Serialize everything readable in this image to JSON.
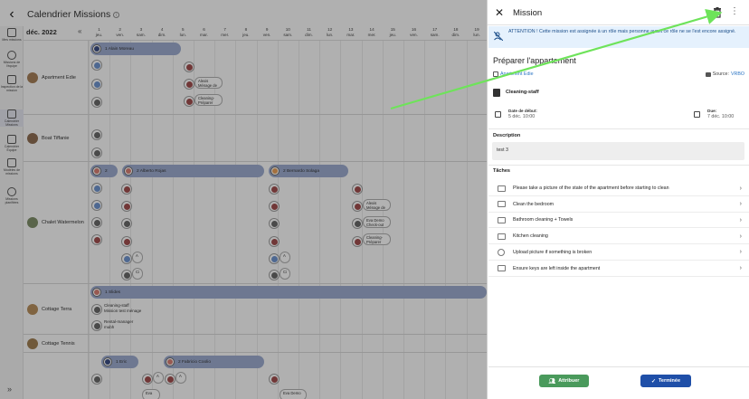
{
  "calendar": {
    "title": "Calendrier Missions",
    "info_icon": "info-icon",
    "month": "déc. 2022",
    "nav_prev": "«",
    "days": [
      {
        "num": "1",
        "dow": "jeu."
      },
      {
        "num": "2",
        "dow": "ven."
      },
      {
        "num": "3",
        "dow": "sam."
      },
      {
        "num": "4",
        "dow": "dim."
      },
      {
        "num": "5",
        "dow": "lun."
      },
      {
        "num": "6",
        "dow": "mar."
      },
      {
        "num": "7",
        "dow": "mer."
      },
      {
        "num": "8",
        "dow": "jeu."
      },
      {
        "num": "9",
        "dow": "ven."
      },
      {
        "num": "10",
        "dow": "sam."
      },
      {
        "num": "11",
        "dow": "dim."
      },
      {
        "num": "12",
        "dow": "lun."
      },
      {
        "num": "13",
        "dow": "mar."
      },
      {
        "num": "14",
        "dow": "mer."
      },
      {
        "num": "15",
        "dow": "jeu."
      },
      {
        "num": "16",
        "dow": "ven."
      },
      {
        "num": "17",
        "dow": "sam."
      },
      {
        "num": "18",
        "dow": "dim."
      },
      {
        "num": "19",
        "dow": "lun."
      }
    ],
    "sidebar": [
      {
        "label": "Mes missions",
        "icon": "calendar-icon"
      },
      {
        "label": "Missions de l'équipe",
        "icon": "team-icon"
      },
      {
        "label": "Inspection de la mission",
        "icon": "inspection-icon"
      },
      {
        "label": "Calendrier Missions",
        "icon": "calendar-icon",
        "active": true
      },
      {
        "label": "Calendrier Équipe",
        "icon": "calendar-team-icon"
      },
      {
        "label": "Modèles de missions",
        "icon": "template-icon"
      },
      {
        "label": "Missions planifiées",
        "icon": "clock-icon"
      }
    ],
    "expand_label": "»",
    "properties": [
      {
        "name": "Apartment Edie"
      },
      {
        "name": "Boat Tiffanie"
      },
      {
        "name": "Chalet Watermelon"
      },
      {
        "name": "Cottage Terra"
      },
      {
        "name": "Cottage Tennis"
      }
    ],
    "bands": {
      "alain": "1  Alain Moreau",
      "alberto": "2  Alberto Rojas",
      "bernardo": "2  Bernardo Solaga",
      "slides": "1  Slides",
      "eric": "1  Eric",
      "fabricio": "2  Fabricio Coolio",
      "two": "2"
    },
    "chips": {
      "alexis_menage": "Alexis\nMénage de",
      "cleaning_preparer": "Cleaning-\nPréparer",
      "alexis_menage2": "Alexis\nMénage de",
      "eva_check": "Eva Demo\nCheck-out",
      "cleaning_preparer2": "Cleaning-\nPréparer",
      "a1": "A",
      "a2": "A",
      "a3": "A",
      "a4": "A",
      "ci": "Ci",
      "ci2": "Ci",
      "eva": "Eva",
      "eva_demo": "Eva Demo"
    },
    "texts": {
      "cleaning_staff_line1": "Cleaning-staff",
      "cleaning_staff_line2": "Mission test ménage",
      "rental_manager_line1": "Rental-manager",
      "rental_manager_line2": "mubh"
    }
  },
  "panel": {
    "title": "Mission",
    "close_icon": "close-icon",
    "delete_icon": "trash-icon",
    "more_icon": "more-vertical-icon",
    "alert": "ATTENTION ! Cette mission est assignée à un rôle mais personne ayant ce rôle ne se l'est encore assigné.",
    "mission_name": "Préparer l'appartement",
    "location": "Apartment Edie",
    "source_label": "Source:",
    "source_value": "VRBO",
    "role": "Cleaning-staff",
    "start_label": "Date de début:",
    "start_value": "5 déc. 10:00",
    "due_label": "Due:",
    "due_value": "7 déc. 10:00",
    "description_title": "Description",
    "description": "test 3",
    "tasks_title": "Tâches",
    "tasks": [
      {
        "label": "Please take a picture of the state of the apartment before starting to clean",
        "icon": "camera-icon"
      },
      {
        "label": "Clean the bedroom",
        "icon": "camera-icon"
      },
      {
        "label": "Bathroom cleaning + Towels",
        "icon": "camera-icon"
      },
      {
        "label": "Kitchen cleaning",
        "icon": "camera-icon"
      },
      {
        "label": "Upload picture if something is broken",
        "icon": "check-circle-icon"
      },
      {
        "label": "Ensure keys are left inside the apartment",
        "icon": "camera-icon"
      }
    ],
    "assign_button": "Attribuer",
    "done_button": "Terminée",
    "colors": {
      "assign": "#4a9a5c",
      "done": "#1f4fa8",
      "alert_bg": "#e5f1fd",
      "link": "#2b75c4",
      "annotation_arrow": "#6ee35a"
    }
  }
}
